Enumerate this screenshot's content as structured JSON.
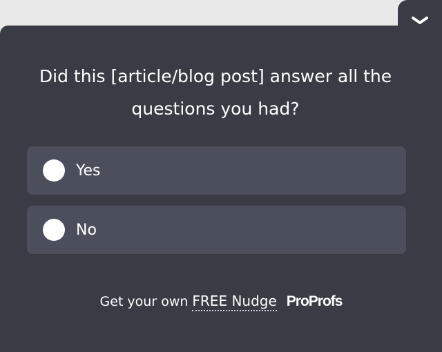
{
  "widget": {
    "question": "Did this [article/blog post] answer all the questions you had?",
    "collapse_icon": "chevron-down-icon",
    "options": [
      {
        "label": "Yes",
        "selected": false
      },
      {
        "label": "No",
        "selected": false
      }
    ]
  },
  "footer": {
    "text": "Get your own",
    "link_label": "FREE Nudge",
    "brand": "ProProfs"
  },
  "colors": {
    "panel_bg": "#393c45",
    "option_bg": "#4b4f5b",
    "page_bg": "#e9e9e9",
    "text": "#ffffff"
  }
}
